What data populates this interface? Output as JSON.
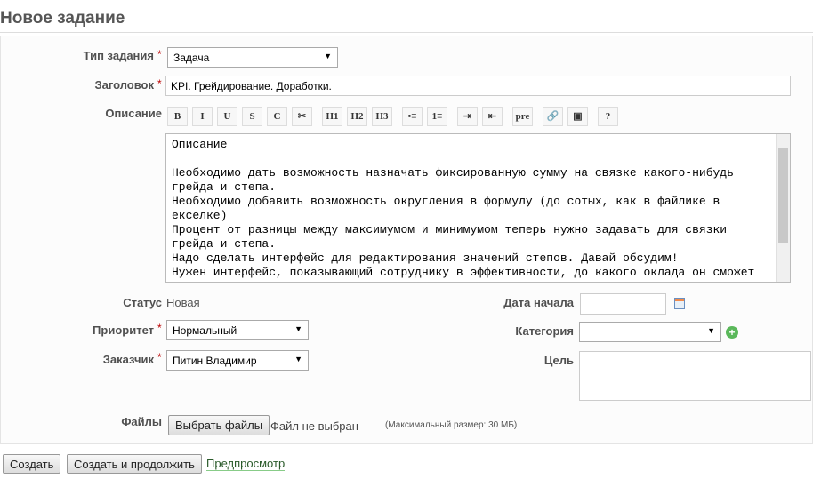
{
  "page_title": "Новое задание",
  "form": {
    "type_label": "Тип задания",
    "type_value": "Задача",
    "subject_label": "Заголовок",
    "subject_value": "KPI. Грейдирование. Доработки.",
    "description_label": "Описание",
    "toolbar": [
      "B",
      "I",
      "U",
      "S",
      "C",
      "✂",
      "H1",
      "H2",
      "H3",
      "•≡",
      "1≡",
      "⇥",
      "⇤",
      "pre",
      "🔗",
      "▣",
      "?"
    ],
    "description_text": "Описание\n\nНеобходимо дать возможность назначать фиксированную сумму на связке какого-нибудь грейда и степа.\nНеобходимо добавить возможность округления в формулу (до сотых, как в файлике в екселке)\nПроцент от разницы между максимумом и минимумом теперь нужно задавать для связки грейда и степа.\nНадо сделать интерфейс для редактирования значений степов. Давай обсудим!\nНужен интерфейс, показывающий сотруднику в эффективности, до какого оклада он сможет",
    "status_label": "Статус",
    "status_value": "Новая",
    "priority_label": "Приоритет",
    "priority_value": "Нормальный",
    "customer_label": "Заказчик",
    "customer_value": "Питин Владимир",
    "start_date_label": "Дата начала",
    "start_date_value": "",
    "category_label": "Категория",
    "category_value": "",
    "goal_label": "Цель",
    "goal_value": "",
    "files_label": "Файлы",
    "choose_files": "Выбрать файлы",
    "no_file": "Файл не выбран",
    "max_size": "(Максимальный размер: 30 МБ)",
    "required_mark": "*"
  },
  "actions": {
    "create": "Создать",
    "create_continue": "Создать и продолжить",
    "preview": "Предпросмотр"
  }
}
